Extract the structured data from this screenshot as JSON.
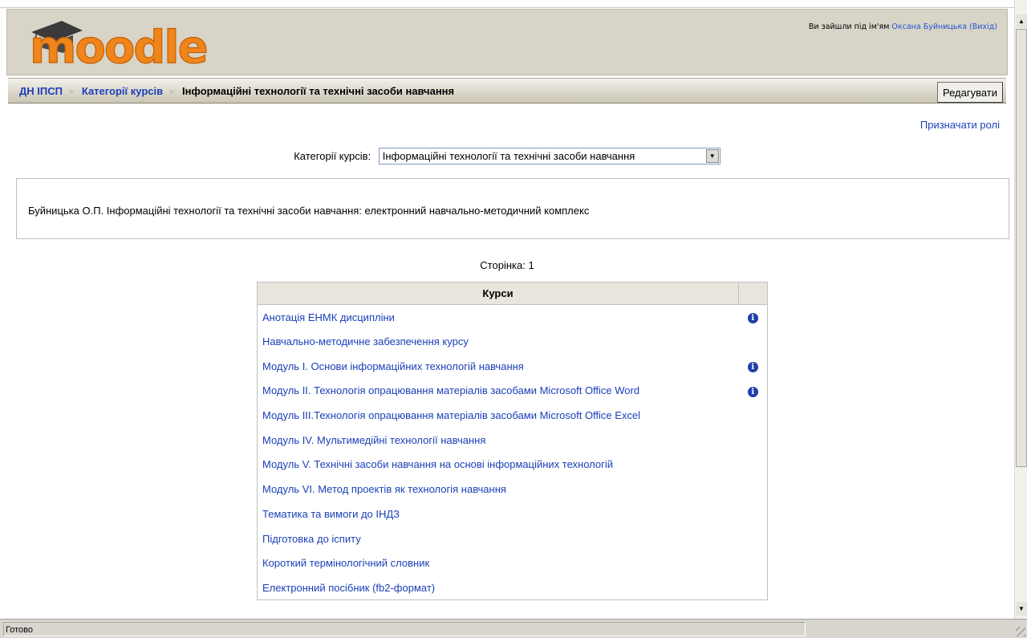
{
  "header": {
    "logo_text": "moodle",
    "login_prefix": "Ви зайшли під ім'ям ",
    "user_name": "Оксана Буйницька",
    "logout_label": "(Вихід)"
  },
  "navbar": {
    "breadcrumb": [
      {
        "label": "ДН ІПСП"
      },
      {
        "label": "Категорії курсів"
      },
      {
        "label": "Інформаційні технології та технічні засоби навчання"
      }
    ],
    "separator": "►",
    "edit_label": "Редагувати"
  },
  "assign_roles_label": "Призначати ролі",
  "category": {
    "label": "Категорії курсів:",
    "selected": "Інформаційні технології та технічні засоби навчання"
  },
  "description": "Буйницька О.П. Інформаційні технології та технічні засоби навчання: електронний навчально-методичний комплекс",
  "paging": "Сторінка:  1",
  "courses": {
    "header": "Курси",
    "items": [
      {
        "name": "Анотація ЕНМК дисципліни",
        "info": true
      },
      {
        "name": "Навчально-методичне забезпечення курсу",
        "info": false
      },
      {
        "name": "Модуль І. Основи інформаційних технологій навчання",
        "info": true
      },
      {
        "name": "Модуль ІІ. Технологія опрацювання матеріалів засобами Microsoft Office Word",
        "info": true
      },
      {
        "name": "Модуль ІІІ.Технологія опрацювання матеріалів засобами Microsoft Office Excel",
        "info": false
      },
      {
        "name": "Модуль IV. Мультимедійні технології навчання",
        "info": false
      },
      {
        "name": "Модуль V. Технічні засоби навчання на основі інформаційних технологій",
        "info": false
      },
      {
        "name": "Модуль VІ. Метод проектів як технологія навчання",
        "info": false
      },
      {
        "name": "Тематика та вимоги до ІНДЗ",
        "info": false
      },
      {
        "name": "Підготовка до іспиту",
        "info": false
      },
      {
        "name": "Короткий термінологічний словник",
        "info": false
      },
      {
        "name": "Електронний посібник (fb2-формат)",
        "info": false
      }
    ]
  },
  "icons": {
    "info": "info-icon",
    "dropdown": "dropdown-arrow-icon",
    "logo": "moodle-graduation-cap-icon"
  },
  "colors": {
    "link": "#1a3fb8",
    "logo_orange": "#f0851b",
    "header_bg": "#d8d4c8",
    "info_icon": "#1e3ea8"
  },
  "statusbar": {
    "text": "Готово"
  }
}
